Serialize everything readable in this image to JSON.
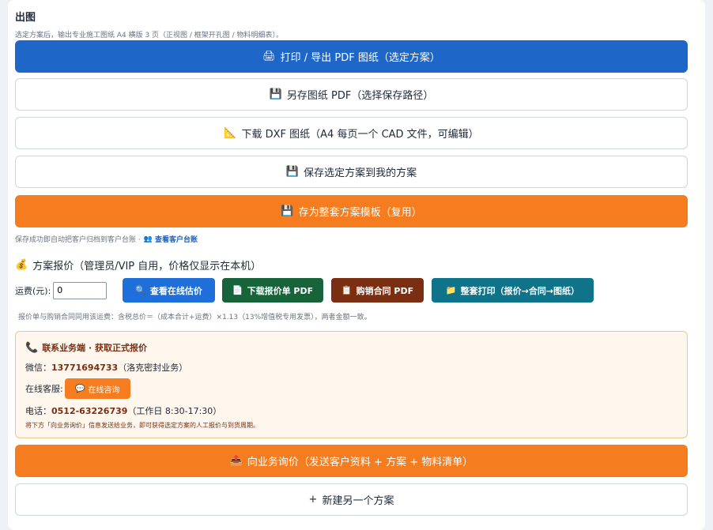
{
  "export": {
    "title": "出图",
    "hint": "选定方案后，输出专业施工图纸 A4 横版 3 页（正视图 / 框架开孔图 / 物料明细表）。",
    "print_pdf": {
      "icon": "printer-icon",
      "glyph": "🖨",
      "label": "打印 / 导出 PDF 图纸（选定方案）"
    },
    "save_pdf": {
      "icon": "floppy-disk-icon",
      "glyph": "💾",
      "label": "另存图纸 PDF（选择保存路径）"
    },
    "download_dxf": {
      "icon": "triangle-ruler-icon",
      "glyph": "📐",
      "label": "下载 DXF 图纸（A4 每页一个 CAD 文件，可编辑）"
    },
    "save_plan": {
      "icon": "floppy-disk-icon",
      "glyph": "💾",
      "label": "保存选定方案到我的方案"
    },
    "save_template": {
      "icon": "floppy-disk-icon",
      "glyph": "💾",
      "label": "存为整套方案模板（复用）"
    },
    "save_note": "保存成功即自动把客户归档到客户台账 ·",
    "ledger_link": {
      "icon": "users-icon",
      "glyph": "👥",
      "label": "查看客户台账"
    }
  },
  "quote": {
    "title_icon": {
      "icon": "money-bag-icon",
      "glyph": "💰"
    },
    "title": "方案报价（管理员/VIP 自用，价格仅显示在本机）",
    "freight_label": "运费(元):",
    "freight_value": "0",
    "buttons": {
      "online_estimate": {
        "icon": "magnifier-icon",
        "glyph": "🔍",
        "label": "查看在线估价"
      },
      "download_quote": {
        "icon": "document-icon",
        "glyph": "📄",
        "label": "下载报价单 PDF"
      },
      "contract": {
        "icon": "clipboard-icon",
        "glyph": "📋",
        "label": "购销合同 PDF"
      },
      "print_all": {
        "icon": "folder-icon",
        "glyph": "📁",
        "label": "整套打印（报价→合同→图纸）"
      }
    },
    "formula": "报价单与购销合同同用该运费：含税总价＝（成本合计+运费）×1.13（13%增值税专用发票），两者金额一致。"
  },
  "contact": {
    "title_icon": {
      "icon": "phone-icon",
      "glyph": "📞"
    },
    "title": "联系业务端 · 获取正式报价",
    "wechat_label": "微信：",
    "wechat_value": "13771694733",
    "wechat_note": "（洛克密封业务）",
    "online_label": "在线客服:",
    "online_button": {
      "icon": "chat-icon",
      "glyph": "💬",
      "label": "在线咨询"
    },
    "phone_label": "电话：",
    "phone_value": "0512-63226739",
    "phone_hours": "（工作日 8:30-17:30）",
    "tip": "将下方「向业务询价」信息发送给业务，即可获得选定方案的人工报价与到货周期。"
  },
  "inquiry": {
    "icon": "outbox-tray-icon",
    "glyph": "📤",
    "label": "向业务询价（发送客户资料 + 方案 + 物料清单）"
  },
  "new_plan": {
    "glyph": "+",
    "label": "新建另一个方案"
  },
  "colors": {
    "primary_blue": "#1e66c8",
    "accent_orange": "#f57c1f",
    "green": "#17633a",
    "brown": "#7a2e12",
    "teal": "#0f7389"
  }
}
